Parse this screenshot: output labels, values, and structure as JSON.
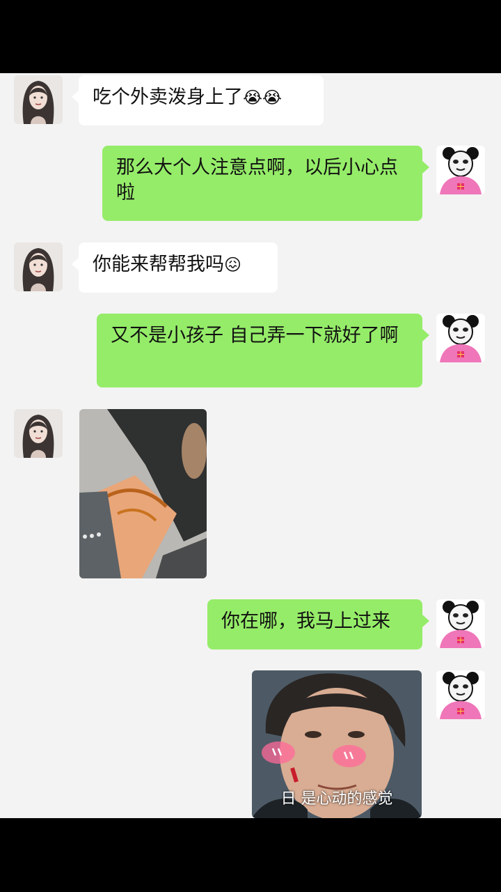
{
  "messages": [
    {
      "side": "in",
      "text": "吃个外卖泼身上了",
      "emoji": "😭😭"
    },
    {
      "side": "out",
      "text": "那么大个人注意点啊，以后小心点啦"
    },
    {
      "side": "in",
      "text": "你能来帮帮我吗",
      "emoji": "😖"
    },
    {
      "side": "out",
      "text": "又不是小孩子 自己弄一下就好了啊"
    },
    {
      "side": "in",
      "type": "image",
      "alt": "spilled food on leg photo"
    },
    {
      "side": "out",
      "text": "你在哪，我马上过来"
    },
    {
      "side": "out",
      "type": "sticker",
      "caption": "日 是心动的感觉"
    }
  ],
  "avatars": {
    "contact": "woman-illustration-avatar",
    "self": "panda-meme-avatar"
  },
  "colors": {
    "background": "#f3f3f3",
    "incoming_bubble": "#ffffff",
    "outgoing_bubble": "#95ec69"
  }
}
